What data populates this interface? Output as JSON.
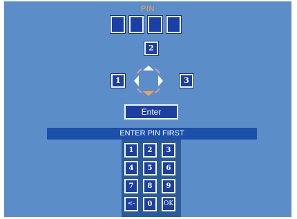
{
  "pin_label": "PIN",
  "pin_slot_count": 4,
  "dpad": {
    "up_value": "2",
    "left_value": "1",
    "right_value": "3"
  },
  "enter_label": "Enter",
  "status_text": "ENTER PIN FIRST",
  "keypad": {
    "keys": [
      "1",
      "2",
      "3",
      "4",
      "5",
      "6",
      "7",
      "8",
      "9",
      "<-",
      "0",
      "OK"
    ]
  },
  "colors": {
    "background": "#5b8ec8",
    "key_fill": "#1d3f9e",
    "status_bar": "#1c4fa9",
    "pin_label": "#f3a24a",
    "arrow_up": "#ffffff",
    "arrow_down": "#f5a05a",
    "dpad_ring": "#d7a0a0"
  }
}
